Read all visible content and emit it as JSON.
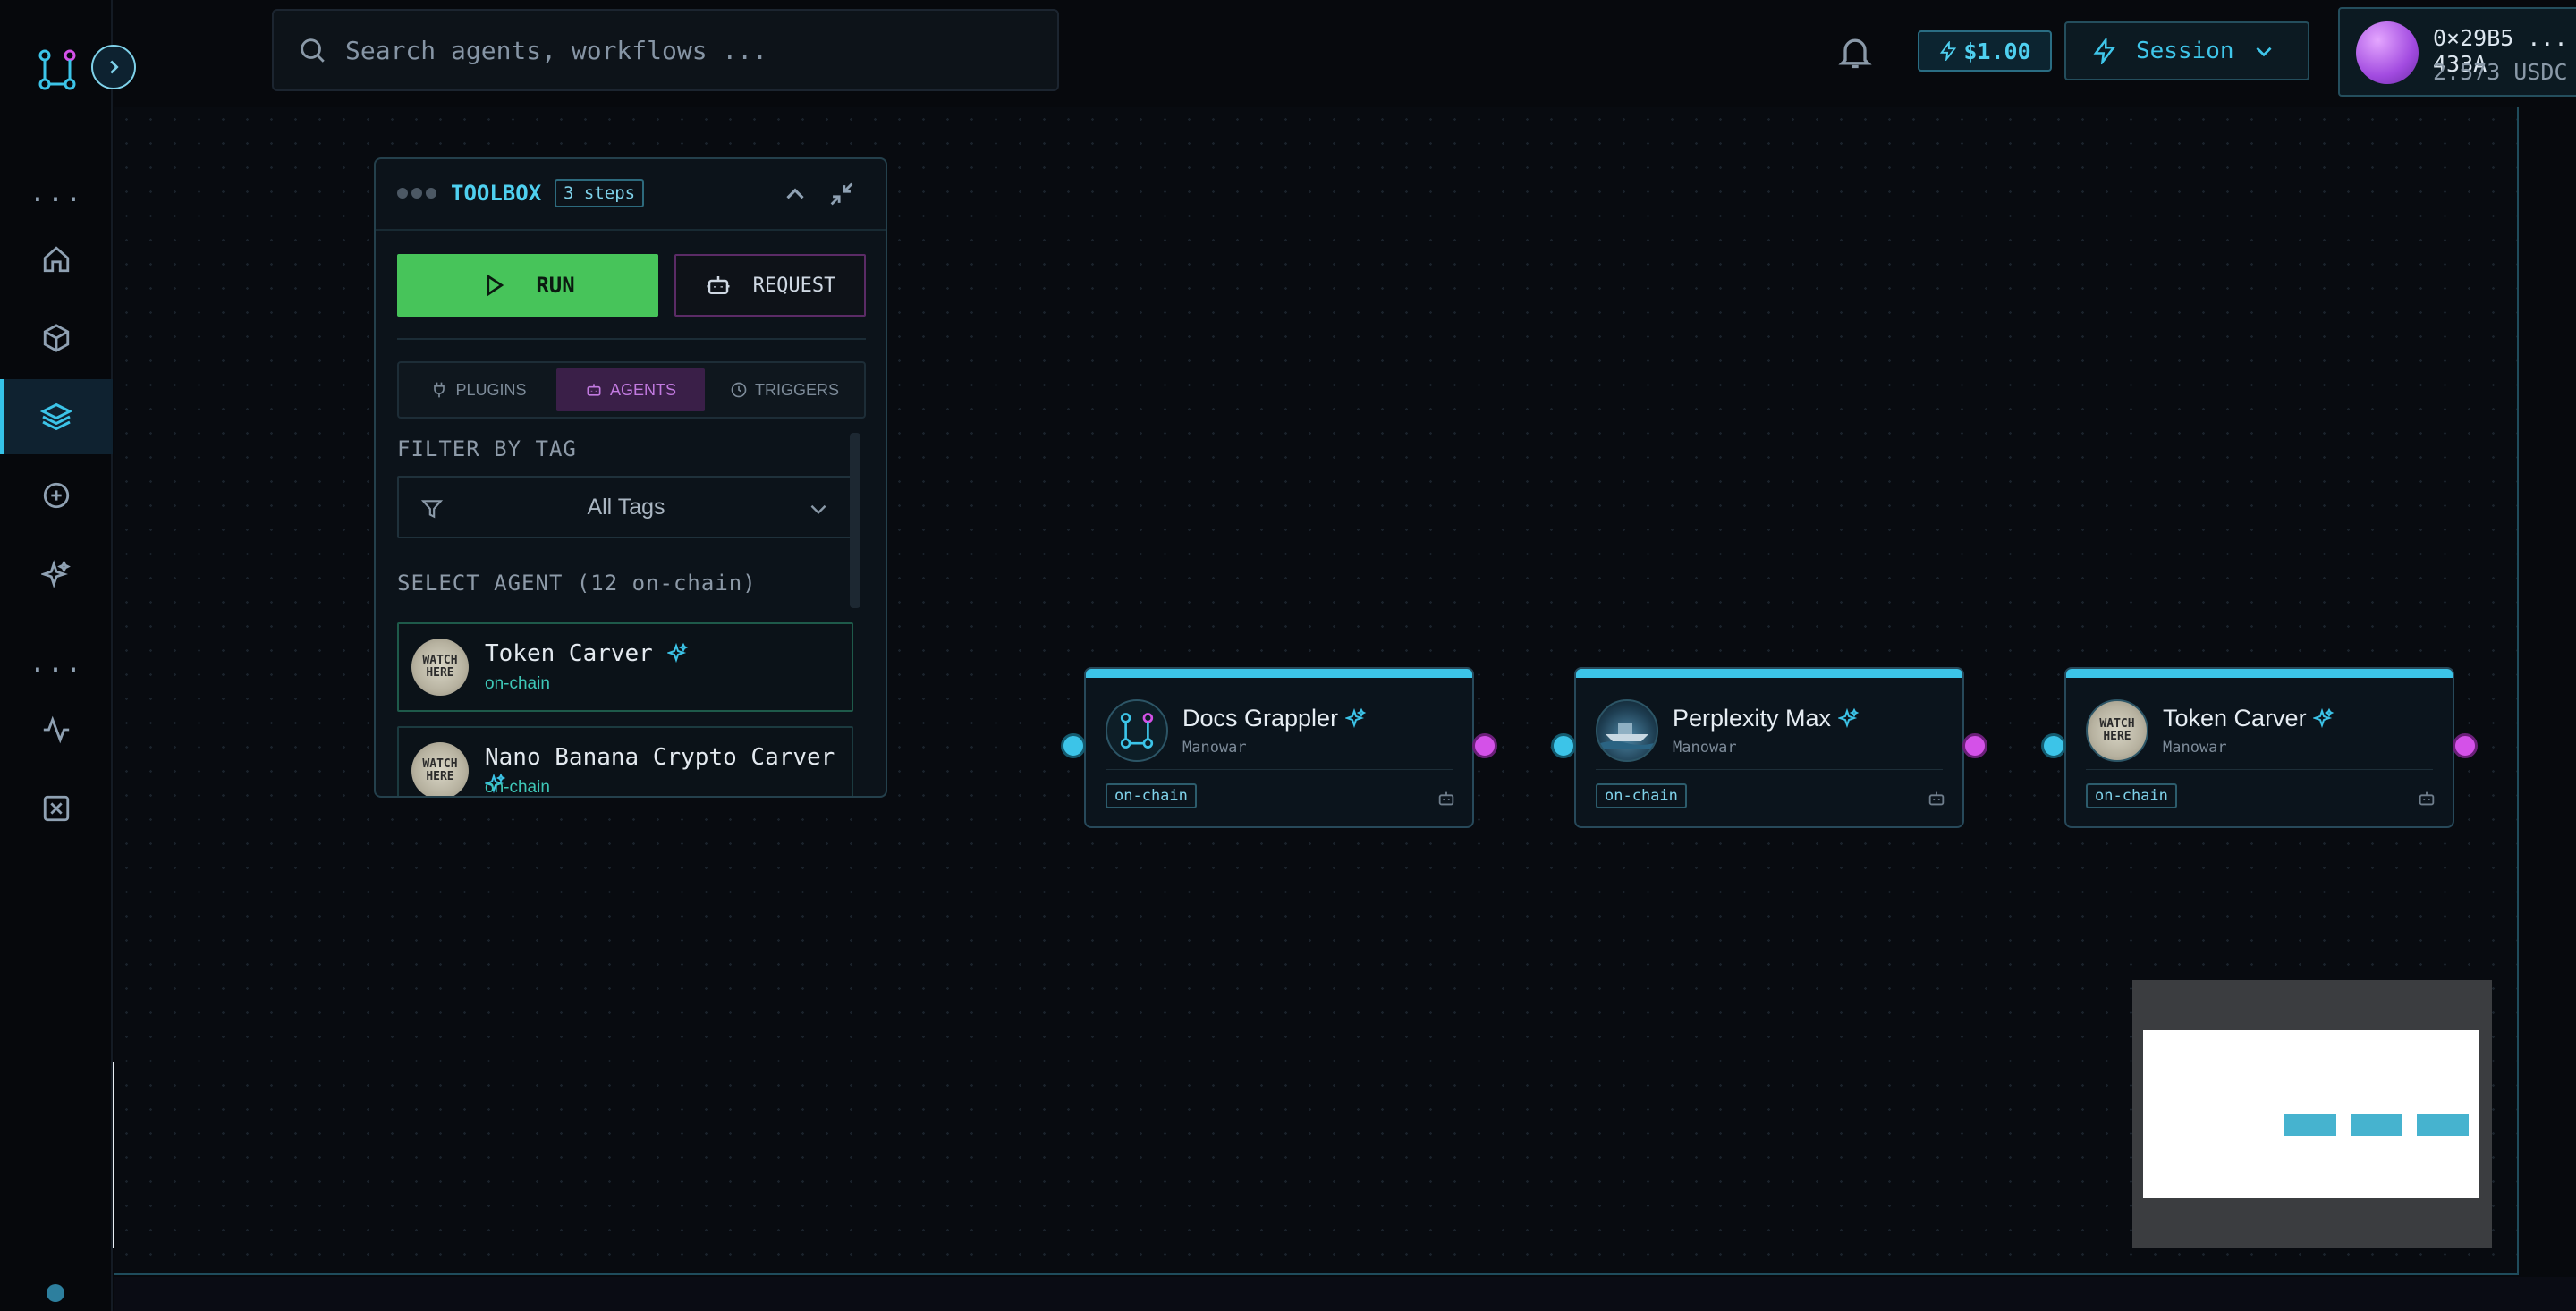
{
  "search": {
    "placeholder": "Search agents, workflows ..."
  },
  "header": {
    "credit": "$1.00",
    "session_label": "Session",
    "wallet_address": "0×29B5 ... 433A",
    "wallet_balance": "2.573 USDC"
  },
  "rail": {
    "dots_top": "...",
    "dots_mid": "...",
    "items": [
      "home",
      "box",
      "layers",
      "add",
      "sparkles",
      "activity",
      "close-square"
    ],
    "active": "layers"
  },
  "toolbox": {
    "title": "TOOLBOX",
    "steps": "3 steps",
    "run_label": "RUN",
    "request_label": "REQUEST",
    "tabs": [
      {
        "label": "PLUGINS",
        "active": false
      },
      {
        "label": "AGENTS",
        "active": true
      },
      {
        "label": "TRIGGERS",
        "active": false
      }
    ],
    "filter_label": "FILTER BY TAG",
    "filter_value": "All Tags",
    "agent_label": "SELECT AGENT (12 on-chain)",
    "agents": [
      {
        "name": "Token Carver",
        "tag": "on-chain"
      },
      {
        "name": "Nano Banana Crypto Carver",
        "tag": "on-chain"
      }
    ]
  },
  "flow": {
    "nodes": [
      {
        "name": "Docs Grappler",
        "provider": "Manowar",
        "badge": "on-chain"
      },
      {
        "name": "Perplexity Max",
        "provider": "Manowar",
        "badge": "on-chain"
      },
      {
        "name": "Token Carver",
        "provider": "Manowar",
        "badge": "on-chain"
      }
    ]
  },
  "avatar_text": {
    "watch": "WATCH",
    "here": "HERE"
  },
  "colors": {
    "accent": "#3cc4e8",
    "run": "#47c45a",
    "port_out": "#d451e8",
    "agent_tab": "#c27ae0"
  }
}
